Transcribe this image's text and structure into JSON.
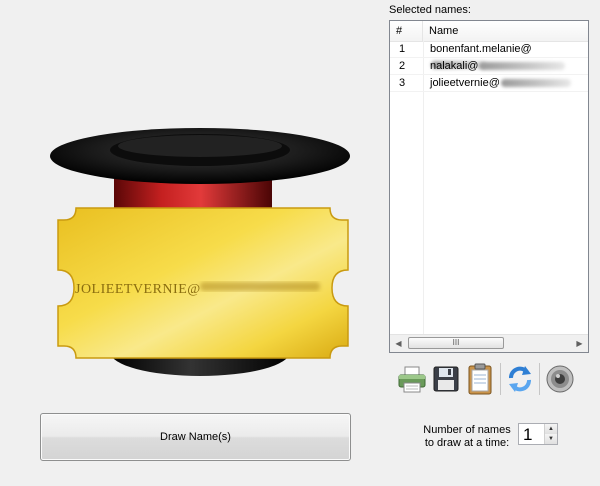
{
  "ticket": {
    "text": "JOLIEETVERNIE@"
  },
  "draw_button": {
    "label": "Draw Name(s)"
  },
  "selected": {
    "label": "Selected names:",
    "columns": [
      "#",
      "Name"
    ],
    "rows": [
      {
        "num": "1",
        "name": "bonenfant.melanie@"
      },
      {
        "num": "2",
        "name": "nalakali@"
      },
      {
        "num": "3",
        "name": "jolieetvernie@"
      }
    ],
    "scroll_grip": "III"
  },
  "toolbar": {
    "icons": [
      "printer-icon",
      "floppy-disk-save-icon",
      "clipboard-icon",
      "refresh-icon",
      "speaker-sound-icon"
    ]
  },
  "count": {
    "label_line1": "Number of names",
    "label_line2": "to draw at a time:",
    "value": "1"
  },
  "colors": {
    "ticket_gold": "#f3d23a",
    "ticket_text": "#8a6d0f",
    "hat_band": "#b01a1a",
    "hat_black": "#111111"
  }
}
